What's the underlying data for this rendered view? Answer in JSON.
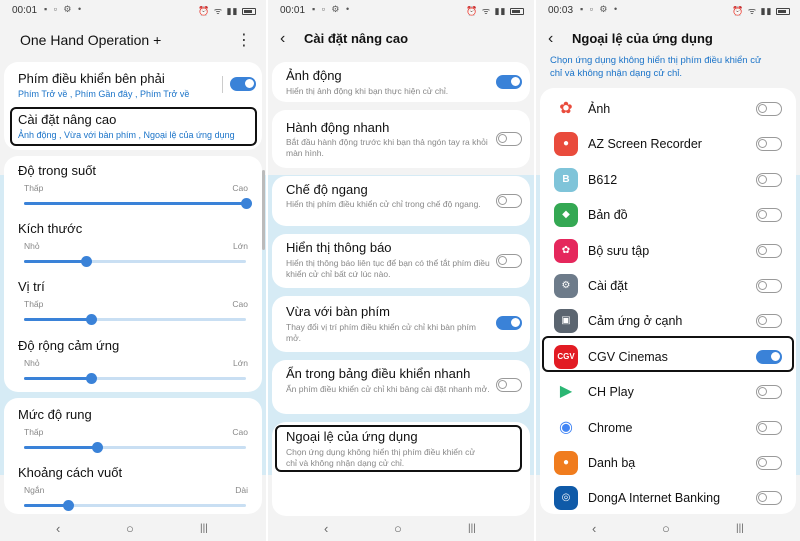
{
  "panel1": {
    "status_time": "00:01",
    "title": "One Hand Operation +",
    "more_icon": "⋮",
    "right_handle": {
      "title": "Phím điều khiển bên phải",
      "subtitle": "Phím Trở về , Phím Gần đây , Phím Trở về",
      "enabled": true
    },
    "advanced": {
      "title": "Cài đặt nâng cao",
      "subtitle": "Ảnh động , Vừa với bàn phím , Ngoại lệ của ứng dụng"
    },
    "sliders": [
      {
        "title": "Độ trong suốt",
        "min_label": "Thấp",
        "max_label": "Cao",
        "value": 1.0
      },
      {
        "title": "Kích thước",
        "min_label": "Nhỏ",
        "max_label": "Lớn",
        "value": 0.28
      },
      {
        "title": "Vị trí",
        "min_label": "Thấp",
        "max_label": "Cao",
        "value": 0.3
      },
      {
        "title": "Độ rộng cảm ứng",
        "min_label": "Nhỏ",
        "max_label": "Lớn",
        "value": 0.3
      },
      {
        "title": "Mức độ rung",
        "min_label": "Thấp",
        "max_label": "Cao",
        "value": 0.33
      },
      {
        "title": "Khoảng cách vuốt",
        "min_label": "Ngắn",
        "max_label": "Dài",
        "value": 0.2
      }
    ]
  },
  "panel2": {
    "status_time": "00:01",
    "title": "Cài đặt nâng cao",
    "items": [
      {
        "title": "Ảnh động",
        "desc": "Hiển thị ảnh động khi bạn thực hiện cử chỉ.",
        "toggle": true
      },
      {
        "title": "Hành động nhanh",
        "desc": "Bắt đầu hành động trước khi bạn thả ngón tay ra khỏi màn hình.",
        "toggle": false
      },
      {
        "title": "Chế độ ngang",
        "desc": "Hiển thị phím điều khiển cử chỉ trong chế độ ngang.",
        "toggle": false
      },
      {
        "title": "Hiển thị thông báo",
        "desc": "Hiển thị thông báo liên tục để bạn có thể tắt phím điều khiển cử chỉ bất cứ lúc nào.",
        "toggle": false
      },
      {
        "title": "Vừa với bàn phím",
        "desc": "Thay đổi vị trí phím điều khiển cử chỉ khi bàn phím mở.",
        "toggle": true
      },
      {
        "title": "Ẩn trong bảng điều khiển nhanh",
        "desc": "Ẩn phím điều khiển cử chỉ khi bảng cài đặt nhanh mở.",
        "toggle": false
      },
      {
        "title": "Ngoại lệ của ứng dụng",
        "desc": "Chọn ứng dụng không hiển thị phím điều khiển cử chỉ và không nhận dạng cử chỉ."
      }
    ]
  },
  "panel3": {
    "status_time": "00:03",
    "title": "Ngoại lệ của ứng dụng",
    "description": "Chọn ứng dụng không hiển thị phím điều khiển cử chỉ và không nhận dạng cử chỉ.",
    "apps": [
      {
        "name": "Ảnh",
        "icon": "photos-icon",
        "color": "#ffffff",
        "enabled": false
      },
      {
        "name": "AZ Screen Recorder",
        "icon": "az-recorder-icon",
        "color": "#e94b3c",
        "enabled": false
      },
      {
        "name": "B612",
        "icon": "b612-icon",
        "color": "#7fc4d9",
        "enabled": false
      },
      {
        "name": "Bản đồ",
        "icon": "maps-icon",
        "color": "#34a853",
        "enabled": false
      },
      {
        "name": "Bộ sưu tập",
        "icon": "gallery-icon",
        "color": "#e5275c",
        "enabled": false
      },
      {
        "name": "Cài đặt",
        "icon": "settings-gear-icon",
        "color": "#6d7b8a",
        "enabled": false
      },
      {
        "name": "Cảm ứng ở cạnh",
        "icon": "edge-touch-icon",
        "color": "#5b6570",
        "enabled": false
      },
      {
        "name": "CGV Cinemas",
        "icon": "cgv-icon",
        "color": "#e21b23",
        "enabled": true
      },
      {
        "name": "CH Play",
        "icon": "play-store-icon",
        "color": "#ffffff",
        "enabled": false
      },
      {
        "name": "Chrome",
        "icon": "chrome-icon",
        "color": "#ffffff",
        "enabled": false
      },
      {
        "name": "Danh bạ",
        "icon": "contacts-icon",
        "color": "#f07c1e",
        "enabled": false
      },
      {
        "name": "DongA Internet Banking",
        "icon": "donga-bank-icon",
        "color": "#0f5aa8",
        "enabled": false
      }
    ]
  },
  "nav": {
    "back": "‹",
    "home": "○",
    "recents": "|||"
  },
  "accent_color": "#3a82d8"
}
